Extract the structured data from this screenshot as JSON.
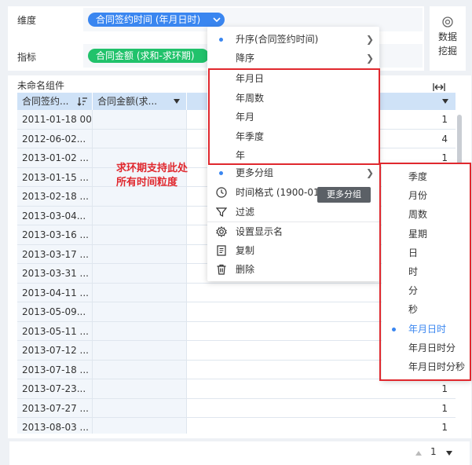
{
  "dimension": {
    "label": "维度",
    "pill": "合同签约时间  (年月日时)"
  },
  "indicator": {
    "label": "指标",
    "pill": "合同金额  (求和-求环期)"
  },
  "mining": {
    "line1": "数据",
    "line2": "挖掘"
  },
  "component_title": "未命名组件",
  "table": {
    "headers": [
      "合同签约...",
      "合同金额(求..."
    ],
    "rows": [
      {
        "date": "2011-01-18  00",
        "value": "1"
      },
      {
        "date": "2012-06-02...",
        "value": "4"
      },
      {
        "date": "2013-01-02 ...",
        "value": "1"
      },
      {
        "date": "2013-01-15 ...",
        "value": ""
      },
      {
        "date": "2013-02-18 ...",
        "value": ""
      },
      {
        "date": "2013-03-04...",
        "value": ""
      },
      {
        "date": "2013-03-16 ...",
        "value": ""
      },
      {
        "date": "2013-03-17 ...",
        "value": ""
      },
      {
        "date": "2013-03-31 ...",
        "value": ""
      },
      {
        "date": "2013-04-11 ...",
        "value": ""
      },
      {
        "date": "2013-05-09...",
        "value": ""
      },
      {
        "date": "2013-05-11 ...",
        "value": ""
      },
      {
        "date": "2013-07-12 ...",
        "value": ""
      },
      {
        "date": "2013-07-18 ...",
        "value": ""
      },
      {
        "date": "2013-07-23...",
        "value": "1"
      },
      {
        "date": "2013-07-27 ...",
        "value": "1"
      },
      {
        "date": "2013-08-03 ...",
        "value": "1"
      }
    ]
  },
  "context_menu": {
    "sort_asc": "升序(合同签约时间)",
    "sort_desc": "降序",
    "grouping": [
      "年月日",
      "年周数",
      "年月",
      "年季度",
      "年"
    ],
    "more_groups": "更多分组",
    "time_format": "时间格式 (1900-01",
    "filter": "过滤",
    "display_name": "设置显示名",
    "copy": "复制",
    "delete": "删除"
  },
  "submenu": {
    "items": [
      "季度",
      "月份",
      "周数",
      "星期",
      "日",
      "时",
      "分",
      "秒",
      "年月日时",
      "年月日时分",
      "年月日时分秒"
    ],
    "selected": "年月日时"
  },
  "tooltip": "更多分组",
  "annotation": {
    "line1": "求环期支持此处",
    "line2": "所有时间粒度"
  },
  "pager": {
    "page": "1"
  },
  "colors": {
    "accent": "#3a86f0",
    "green": "#21c26b",
    "annotation_red": "#e0282e"
  }
}
